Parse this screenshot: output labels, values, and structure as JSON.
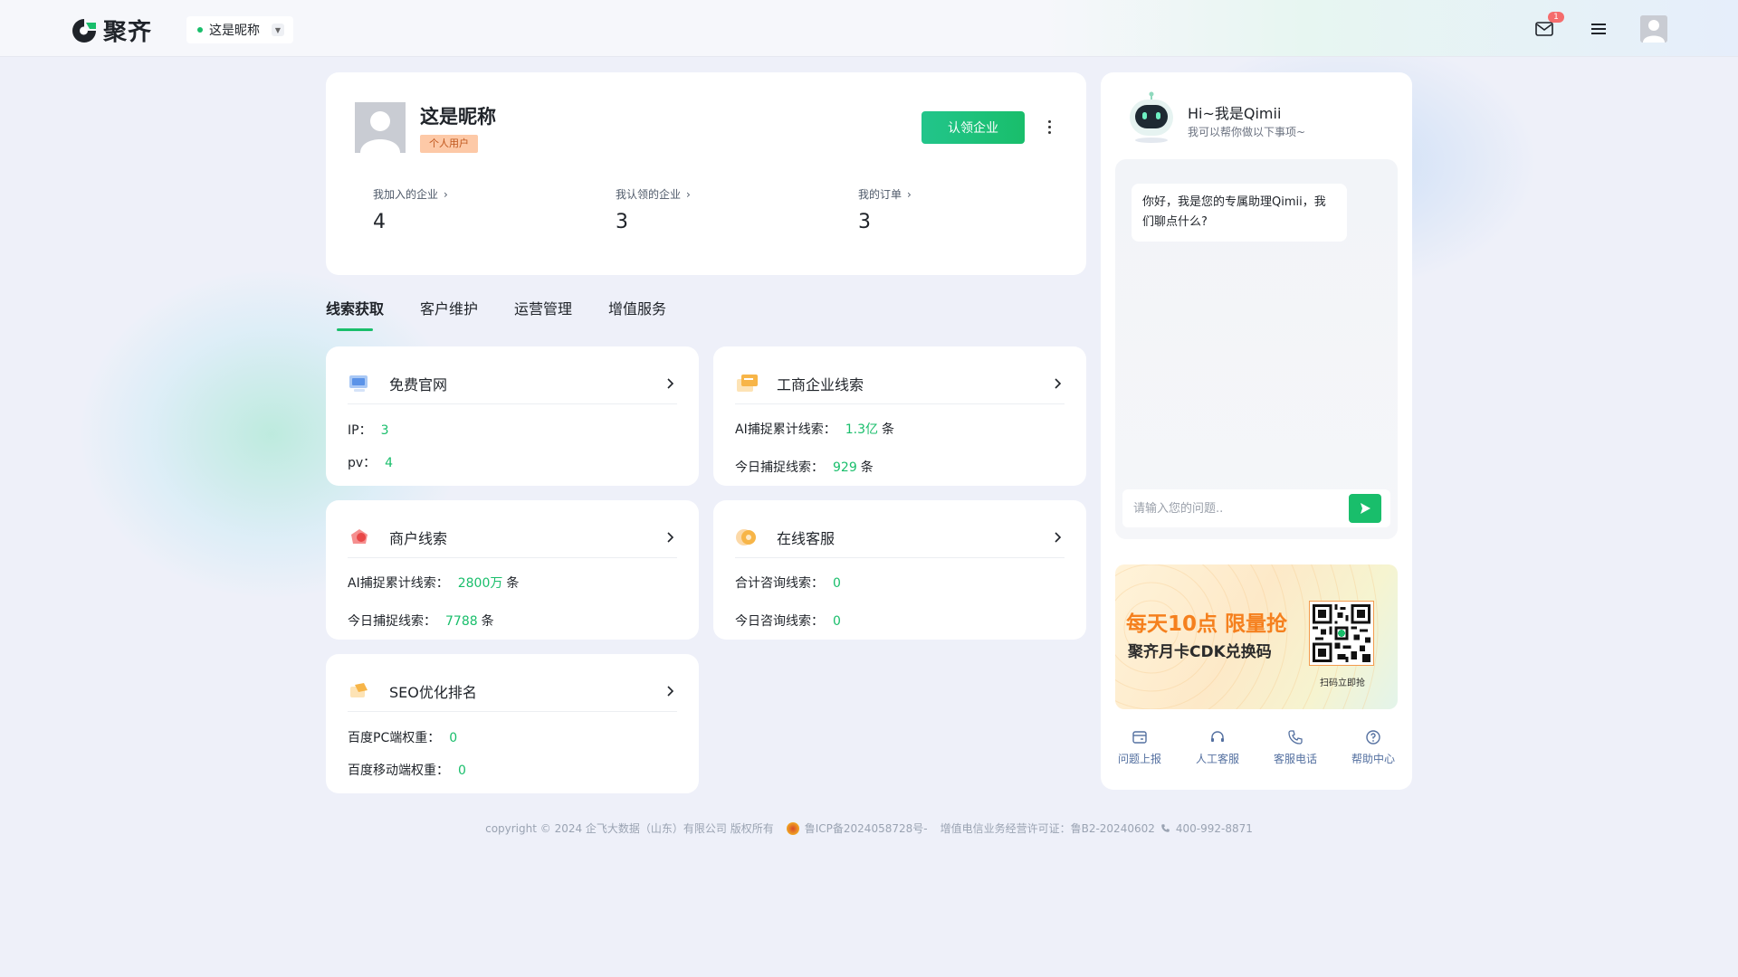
{
  "brand": {
    "name": "聚齐",
    "accent": "#19be6b"
  },
  "topbar": {
    "nickname": "这是昵称",
    "mail_badge": "1",
    "icons": [
      "mail-icon",
      "menu-icon",
      "avatar"
    ]
  },
  "profile": {
    "name": "这是昵称",
    "tag": "个人用户",
    "claim_button": "认领企业",
    "stats": [
      {
        "label": "我加入的企业",
        "value": "4"
      },
      {
        "label": "我认领的企业",
        "value": "3"
      },
      {
        "label": "我的订单",
        "value": "3"
      }
    ]
  },
  "tabs": [
    "线索获取",
    "客户维护",
    "运营管理",
    "增值服务"
  ],
  "active_tab": "线索获取",
  "services": [
    {
      "title": "免费官网",
      "icon": "website-icon",
      "rows": [
        {
          "label": "IP：",
          "value": "3",
          "unit": ""
        },
        {
          "label": "pv：",
          "value": "4",
          "unit": ""
        }
      ]
    },
    {
      "title": "工商企业线索",
      "icon": "business-clue-icon",
      "rows": [
        {
          "label": "AI捕捉累计线索：",
          "value": "1.3亿",
          "unit": "条"
        },
        {
          "label": "今日捕捉线索：",
          "value": "929",
          "unit": "条"
        }
      ]
    },
    {
      "title": "商户线索",
      "icon": "merchant-clue-icon",
      "rows": [
        {
          "label": "AI捕捉累计线索：",
          "value": "2800万",
          "unit": "条"
        },
        {
          "label": "今日捕捉线索：",
          "value": "7788",
          "unit": "条"
        }
      ]
    },
    {
      "title": "在线客服",
      "icon": "online-service-icon",
      "rows": [
        {
          "label": "合计咨询线索：",
          "value": "0",
          "unit": ""
        },
        {
          "label": "今日咨询线索：",
          "value": "0",
          "unit": ""
        }
      ]
    },
    {
      "title": "SEO优化排名",
      "icon": "seo-icon",
      "rows": [
        {
          "label": "百度PC端权重：",
          "value": "0",
          "unit": ""
        },
        {
          "label": "百度移动端权重：",
          "value": "0",
          "unit": ""
        }
      ]
    }
  ],
  "assistant": {
    "greeting": "Hi~我是Qimii",
    "subtitle": "我可以帮你做以下事项~",
    "message": "你好，我是您的专属助理Qimii，我们聊点什么?",
    "input_placeholder": "请输入您的问题..",
    "promo": {
      "line1": "每天10点 限量抢",
      "line2": "聚齐月卡CDK兑换码",
      "qr_caption": "扫码立即抢"
    },
    "quick_links": [
      {
        "label": "问题上报",
        "icon": "report-icon"
      },
      {
        "label": "人工客服",
        "icon": "headset-icon"
      },
      {
        "label": "客服电话",
        "icon": "phone-icon"
      },
      {
        "label": "帮助中心",
        "icon": "help-icon"
      }
    ]
  },
  "footer": {
    "copyright": "copyright © 2024 企飞大数据（山东）有限公司 版权所有",
    "icp": "鲁ICP备2024058728号-",
    "license": "增值电信业务经营许可证：鲁B2-20240602",
    "phone": "400-992-8871"
  }
}
